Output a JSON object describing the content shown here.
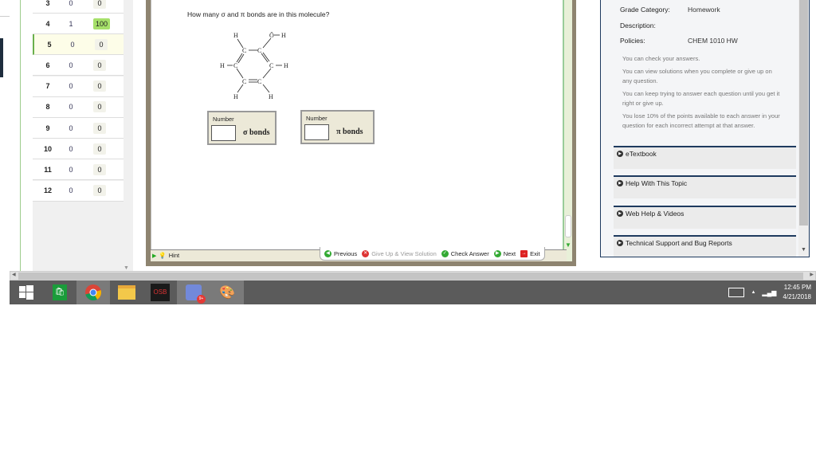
{
  "scores": {
    "rows": [
      {
        "num": "3",
        "attempts": "0",
        "score": "0"
      },
      {
        "num": "4",
        "attempts": "1",
        "score": "100"
      },
      {
        "num": "5",
        "attempts": "0",
        "score": "0"
      },
      {
        "num": "6",
        "attempts": "0",
        "score": "0"
      },
      {
        "num": "7",
        "attempts": "0",
        "score": "0"
      },
      {
        "num": "8",
        "attempts": "0",
        "score": "0"
      },
      {
        "num": "9",
        "attempts": "0",
        "score": "0"
      },
      {
        "num": "10",
        "attempts": "0",
        "score": "0"
      },
      {
        "num": "11",
        "attempts": "0",
        "score": "0"
      },
      {
        "num": "12",
        "attempts": "0",
        "score": "0"
      }
    ],
    "current": "5",
    "full_color": "#a6e06a"
  },
  "question": {
    "text": "How many σ and π bonds are in this molecule?",
    "molecule_atoms": {
      "h": "H",
      "c": "C",
      "o": "Ö"
    },
    "sigma_box": {
      "label": "Number",
      "value": "",
      "unit": "σ  bonds"
    },
    "pi_box": {
      "label": "Number",
      "value": "",
      "unit": "π  bonds"
    }
  },
  "toolbar": {
    "hint": "Hint",
    "previous": "Previous",
    "give_up": "Give Up & View Solution",
    "check": "Check Answer",
    "next": "Next",
    "exit": "Exit"
  },
  "info": {
    "grade_category_label": "Grade Category:",
    "grade_category": "Homework",
    "description_label": "Description:",
    "policies_label": "Policies:",
    "policies": "CHEM 1010 HW",
    "policy_lines": [
      "You can check your answers.",
      "You can view solutions when you complete or give up on any question.",
      "You can keep trying to answer each question until you get it right or give up.",
      "You lose 10% of the points available to each answer in your question for each incorrect attempt at that answer."
    ],
    "sections": [
      "eTextbook",
      "Help With This Topic",
      "Web Help & Videos",
      "Technical Support and Bug Reports"
    ],
    "accent": "#1e3a5f"
  },
  "taskbar": {
    "apps": [
      "windows-start",
      "store",
      "chrome",
      "file-explorer",
      "osb",
      "discord",
      "paint"
    ],
    "osb_label": "OSB",
    "discord_badge": "9+",
    "time": "12:45 PM",
    "date": "4/21/2018"
  }
}
